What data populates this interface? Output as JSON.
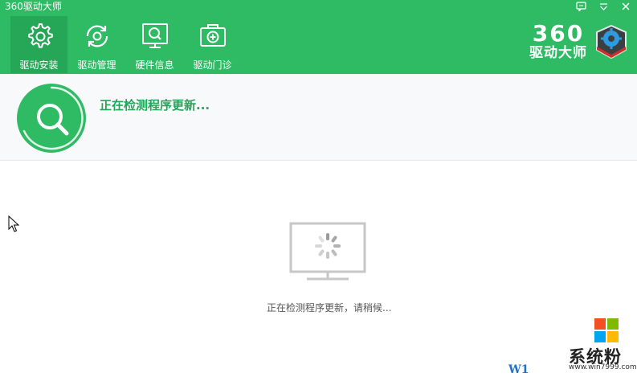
{
  "window": {
    "title": "360驱动大师",
    "controls": [
      "feedback-icon",
      "menu-icon",
      "close-icon"
    ]
  },
  "colors": {
    "header_bg": "#2fba64",
    "active_tab_bg": "#26a757",
    "status_green": "#25a55a",
    "panel_bg": "#f8f9fb"
  },
  "nav": {
    "items": [
      {
        "label": "驱动安装",
        "icon": "gear-icon",
        "active": true
      },
      {
        "label": "驱动管理",
        "icon": "refresh-gear-icon",
        "active": false
      },
      {
        "label": "硬件信息",
        "icon": "monitor-search-icon",
        "active": false
      },
      {
        "label": "驱动门诊",
        "icon": "medical-kit-icon",
        "active": false
      }
    ]
  },
  "logo": {
    "number": "360",
    "name": "驱动大师"
  },
  "status": {
    "title": "正在检测程序更新..."
  },
  "main": {
    "wait_message": "正在检测程序更新，请稍候..."
  },
  "watermark": {
    "prefix": "W1",
    "name": "系统粉",
    "url": "www.win7999.com"
  }
}
